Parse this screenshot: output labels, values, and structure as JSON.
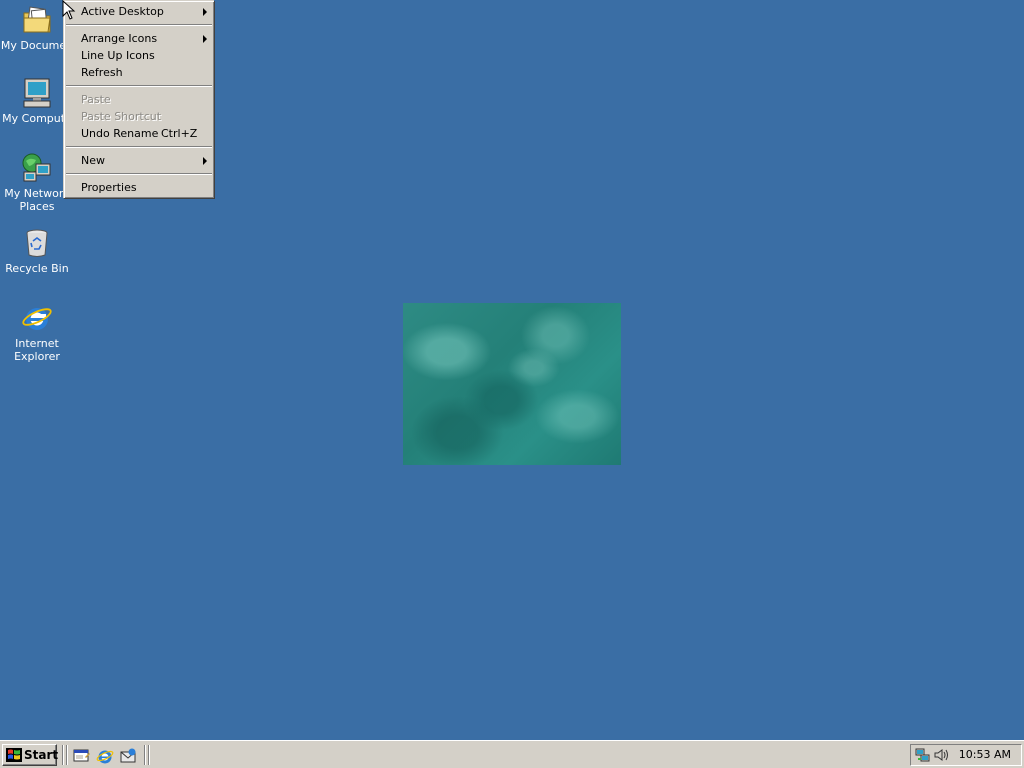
{
  "desktop": {
    "background_color": "#3a6ea5",
    "icons": [
      {
        "label": "My Documen",
        "icon": "my-documents-folder-icon"
      },
      {
        "label": "My Compute",
        "icon": "my-computer-icon"
      },
      {
        "label": "My Network Places",
        "icon": "network-places-icon"
      },
      {
        "label": "Recycle Bin",
        "icon": "recycle-bin-icon"
      },
      {
        "label": "Internet Explorer",
        "icon": "internet-explorer-icon"
      }
    ]
  },
  "context_menu": {
    "items": [
      {
        "label": "Active Desktop",
        "submenu": true,
        "disabled": false
      },
      {
        "label": "Arrange Icons",
        "submenu": true,
        "disabled": false
      },
      {
        "label": "Line Up Icons",
        "submenu": false,
        "disabled": false
      },
      {
        "label": "Refresh",
        "submenu": false,
        "disabled": false
      },
      {
        "label": "Paste",
        "submenu": false,
        "disabled": true
      },
      {
        "label": "Paste Shortcut",
        "submenu": false,
        "disabled": true
      },
      {
        "label": "Undo Rename",
        "shortcut": "Ctrl+Z",
        "submenu": false,
        "disabled": false
      },
      {
        "label": "New",
        "submenu": true,
        "disabled": false
      },
      {
        "label": "Properties",
        "submenu": false,
        "disabled": false
      }
    ]
  },
  "taskbar": {
    "start_label": "Start",
    "quick_launch": [
      "show-desktop-icon",
      "internet-explorer-icon",
      "outlook-express-icon"
    ],
    "tray_icons": [
      "network-connection-icon",
      "volume-icon"
    ],
    "clock": "10:53 AM"
  }
}
